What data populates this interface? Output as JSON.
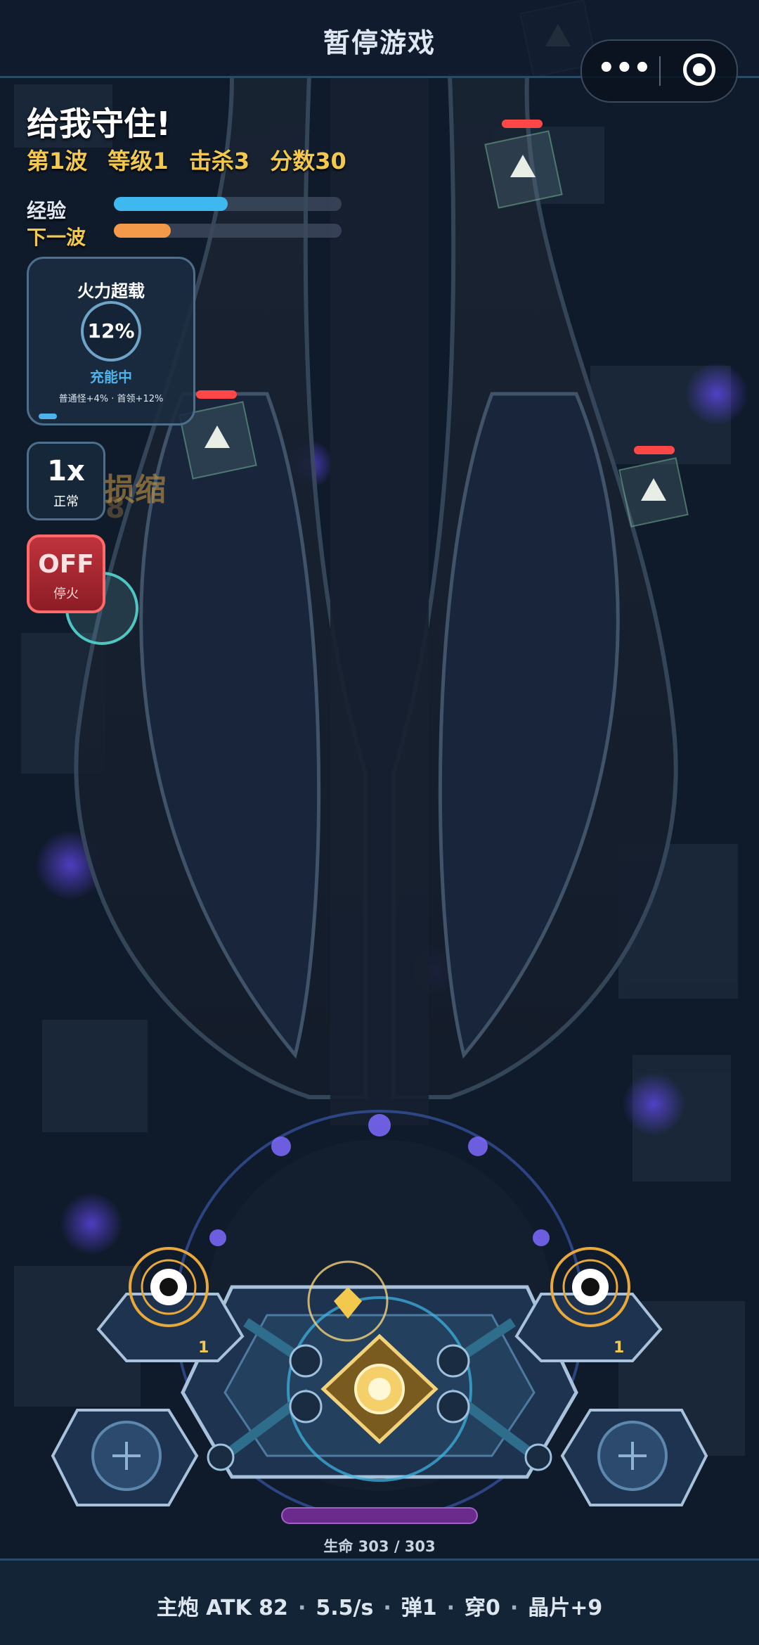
{
  "topbar": {
    "title": "暂停游戏",
    "more_icon": "more-dots-icon",
    "close_icon": "target-circle-icon"
  },
  "header": {
    "title": "给我守住!",
    "wave": "第1波",
    "level": "等级1",
    "kills": "击杀3",
    "score": "分数30"
  },
  "bars": {
    "exp_label": "经验",
    "exp_fraction": 0.5,
    "exp_color": "#3fb8ef",
    "next_wave_label": "下一波",
    "next_wave_fraction": 0.25,
    "next_wave_color": "#f39a4a"
  },
  "overload": {
    "title": "火力超载",
    "percent": "12%",
    "status": "充能中",
    "bonus": "普通怪+4% · 首领+12%",
    "progress_fraction": 0.12
  },
  "speed": {
    "value": "1x",
    "label": "正常"
  },
  "fire": {
    "value": "OFF",
    "label": "停火"
  },
  "ghost_text": {
    "label": "损缩",
    "number": "8"
  },
  "enemies": [
    {
      "name": "enemy-1",
      "health_fraction": 1.0
    },
    {
      "name": "enemy-2",
      "health_fraction": 1.0
    },
    {
      "name": "enemy-3",
      "health_fraction": 1.0
    },
    {
      "name": "enemy-4",
      "health_fraction": 1.0
    }
  ],
  "turrets": {
    "left_level": "1",
    "right_level": "1"
  },
  "base": {
    "hp_text": "生命 303 / 303",
    "hp_fraction": 1.0,
    "hp_color": "#6b2b8c"
  },
  "footer": {
    "main_gun": "主炮 ATK 82",
    "rate": "5.5/s",
    "bullets": "弹1",
    "pierce": "穿0",
    "shards": "晶片+9",
    "separator": "·"
  }
}
